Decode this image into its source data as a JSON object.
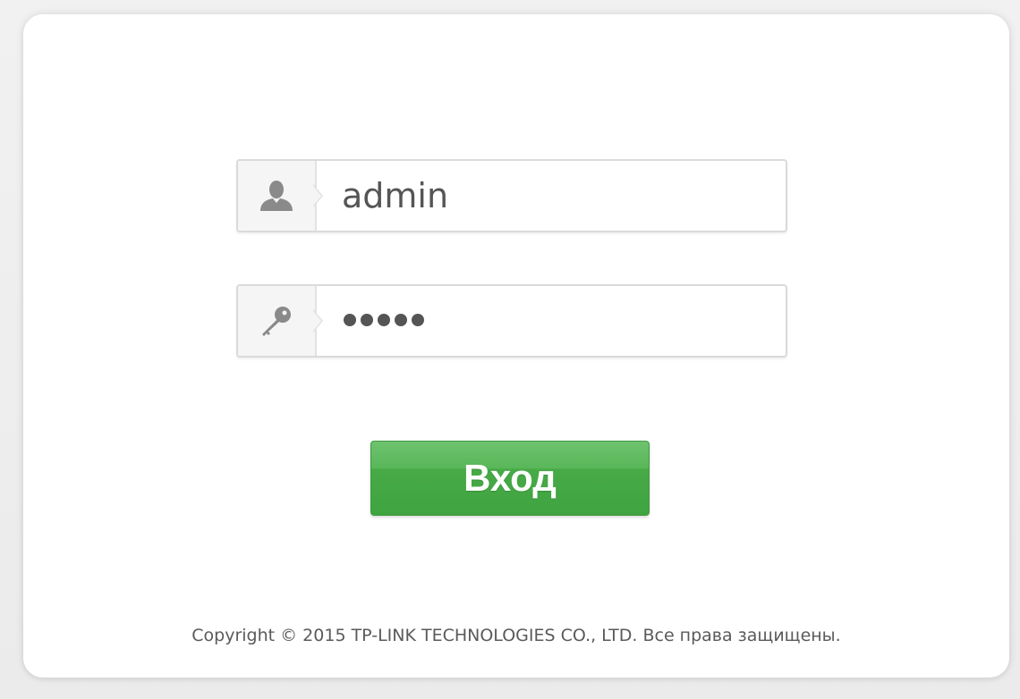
{
  "login": {
    "username": {
      "icon": "user-icon",
      "value": "admin"
    },
    "password": {
      "icon": "key-icon",
      "masked_length": 5
    },
    "submit_label": "Вход"
  },
  "footer": {
    "copyright": "Copyright © 2015 TP-LINK TECHNOLOGIES CO., LTD. Все права защищены."
  },
  "colors": {
    "button_green": "#4caf50",
    "panel_background": "#ffffff",
    "page_background": "#ececec",
    "text": "#555555"
  }
}
